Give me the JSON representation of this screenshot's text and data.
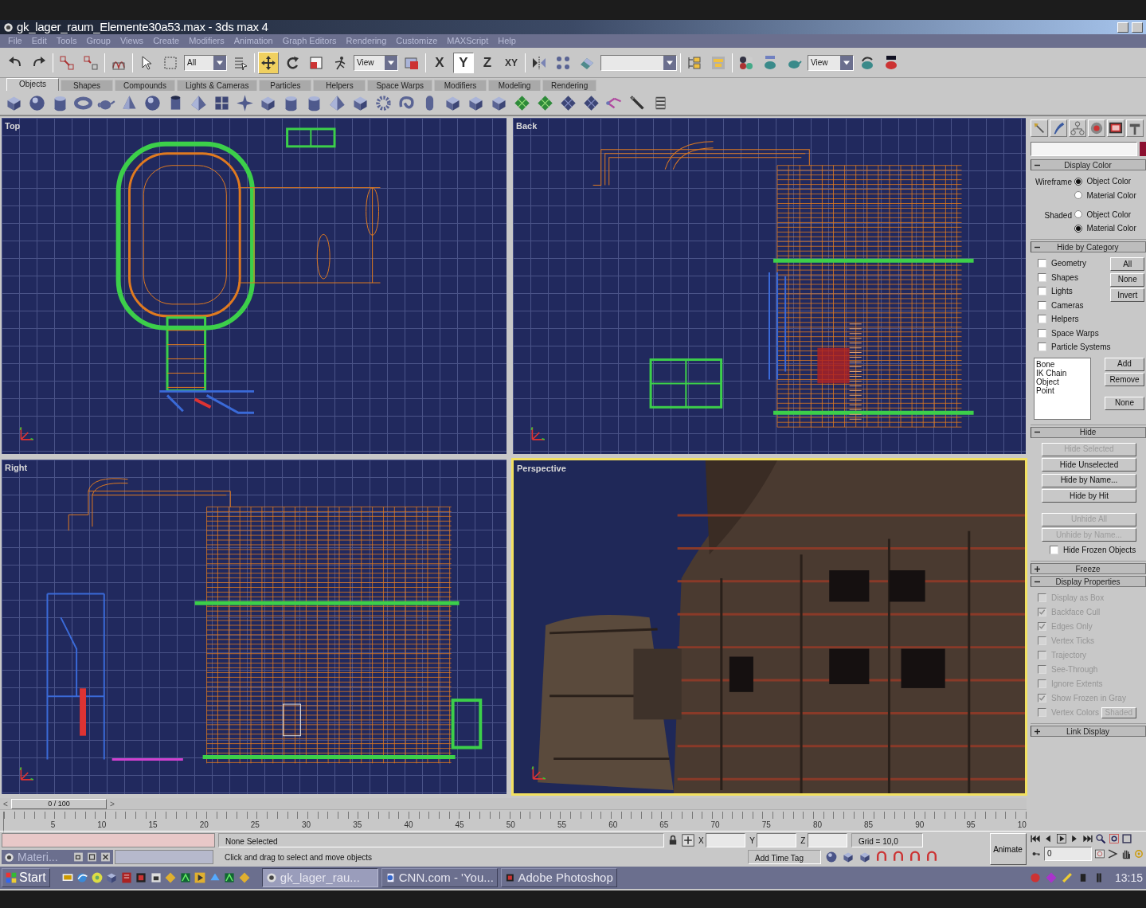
{
  "window": {
    "title": "gk_lager_raum_Elemente30a53.max - 3ds max 4",
    "menu": [
      "File",
      "Edit",
      "Tools",
      "Group",
      "Views",
      "Create",
      "Modifiers",
      "Animation",
      "Graph Editors",
      "Rendering",
      "Customize",
      "MAXScript",
      "Help"
    ]
  },
  "main_toolbar": {
    "selection_filter": "All",
    "reference_coord": "View",
    "render_view": "View",
    "transform_tools": [
      {
        "selected": true
      },
      {
        "selected": false
      },
      {
        "selected": false
      }
    ],
    "axis_constraints": [
      {
        "label": "X",
        "selected": false
      },
      {
        "label": "Y",
        "selected": true
      },
      {
        "label": "Z",
        "selected": false
      },
      {
        "label": "XY",
        "selected": false
      }
    ]
  },
  "tab_panel": {
    "tabs": [
      {
        "label": "Objects",
        "selected": true
      },
      {
        "label": "Shapes",
        "selected": false
      },
      {
        "label": "Compounds",
        "selected": false
      },
      {
        "label": "Lights & Cameras",
        "selected": false
      },
      {
        "label": "Particles",
        "selected": false
      },
      {
        "label": "Helpers",
        "selected": false
      },
      {
        "label": "Space Warps",
        "selected": false
      },
      {
        "label": "Modifiers",
        "selected": false
      },
      {
        "label": "Modeling",
        "selected": false
      },
      {
        "label": "Rendering",
        "selected": false
      }
    ]
  },
  "viewports": [
    {
      "label": "Top",
      "kind": "top",
      "active": false
    },
    {
      "label": "Back",
      "kind": "back",
      "active": false
    },
    {
      "label": "Right",
      "kind": "right",
      "active": false
    },
    {
      "label": "Perspective",
      "kind": "perspective",
      "active": true
    }
  ],
  "command_panel": {
    "rollouts": [
      {
        "kind": "display_color",
        "title": "Display Color",
        "expanded": true,
        "groups": [
          {
            "label": "Wireframe",
            "options": [
              {
                "label": "Object Color",
                "selected": true
              },
              {
                "label": "Material Color",
                "selected": false
              }
            ]
          },
          {
            "label": "Shaded",
            "options": [
              {
                "label": "Object Color",
                "selected": false
              },
              {
                "label": "Material Color",
                "selected": true
              }
            ]
          }
        ]
      },
      {
        "kind": "hide_by_category",
        "title": "Hide by Category",
        "expanded": true,
        "checkboxes": [
          {
            "label": "Geometry",
            "checked": false
          },
          {
            "label": "Shapes",
            "checked": false
          },
          {
            "label": "Lights",
            "checked": false
          },
          {
            "label": "Cameras",
            "checked": false
          },
          {
            "label": "Helpers",
            "checked": false
          },
          {
            "label": "Space Warps",
            "checked": false
          },
          {
            "label": "Particle Systems",
            "checked": false
          }
        ],
        "buttons": [
          "All",
          "None",
          "Invert"
        ],
        "list": [
          "Bone",
          "IK Chain Object",
          "Point"
        ],
        "list_buttons": [
          "Add",
          "Remove",
          "None"
        ]
      },
      {
        "kind": "hide",
        "title": "Hide",
        "expanded": true,
        "buttons": [
          {
            "label": "Hide Selected",
            "disabled": true
          },
          {
            "label": "Hide Unselected",
            "disabled": false
          },
          {
            "label": "Hide by Name...",
            "disabled": false
          },
          {
            "label": "Hide by Hit",
            "disabled": false
          },
          {
            "label": "Unhide All",
            "disabled": true
          },
          {
            "label": "Unhide by Name...",
            "disabled": true
          }
        ],
        "checkboxes": [
          {
            "label": "Hide Frozen Objects",
            "checked": false,
            "disabled": false
          }
        ]
      },
      {
        "title": "Freeze",
        "expanded": false
      },
      {
        "kind": "display_properties",
        "title": "Display Properties",
        "expanded": true,
        "checkboxes": [
          {
            "label": "Display as Box",
            "checked": false,
            "disabled": true
          },
          {
            "label": "Backface Cull",
            "checked": true,
            "disabled": true
          },
          {
            "label": "Edges Only",
            "checked": true,
            "disabled": true
          },
          {
            "label": "Vertex Ticks",
            "checked": false,
            "disabled": true
          },
          {
            "label": "Trajectory",
            "checked": false,
            "disabled": true
          },
          {
            "label": "See-Through",
            "checked": false,
            "disabled": true
          },
          {
            "label": "Ignore Extents",
            "checked": false,
            "disabled": true
          },
          {
            "label": "Show Frozen in Gray",
            "checked": true,
            "disabled": true
          },
          {
            "label": "Vertex Colors",
            "checked": false,
            "disabled": true,
            "button": "Shaded"
          }
        ]
      },
      {
        "title": "Link Display",
        "expanded": false
      }
    ]
  },
  "timeline": {
    "frame_label": "0 / 100",
    "level": 0,
    "prev": "<",
    "next": ">",
    "ticks": [
      "5",
      "10",
      "15",
      "20",
      "25",
      "30",
      "35",
      "40",
      "45",
      "50",
      "55",
      "60",
      "65",
      "70",
      "75",
      "80",
      "85",
      "90",
      "95",
      "10"
    ]
  },
  "status_bar": {
    "minimized_window": "Materi...",
    "selection": "None Selected",
    "prompt": "Click and drag to select and move objects",
    "coords": [
      "X",
      "Y",
      "Z"
    ],
    "grid": "Grid = 10,0",
    "time_tag": "Add Time Tag",
    "animate": "Animate",
    "frame": "0"
  },
  "taskbar": {
    "start": "Start",
    "tasks": [
      {
        "label": "gk_lager_rau...",
        "selected": true
      },
      {
        "label": "CNN.com - 'You...",
        "selected": false
      },
      {
        "label": "Adobe Photoshop",
        "selected": false
      }
    ],
    "clock": "13:15"
  }
}
